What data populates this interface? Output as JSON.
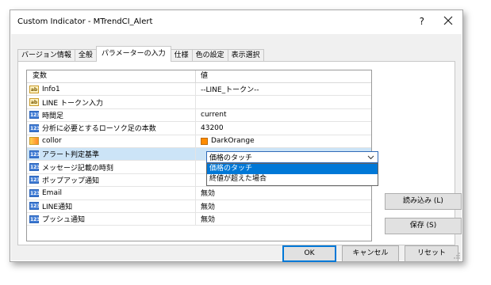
{
  "window": {
    "title": "Custom Indicator - MTrendCI_Alert",
    "help_label": "?"
  },
  "tabs": [
    {
      "label": "バージョン情報"
    },
    {
      "label": "全般"
    },
    {
      "label": "パラメーターの入力"
    },
    {
      "label": "仕様"
    },
    {
      "label": "色の設定"
    },
    {
      "label": "表示選択"
    }
  ],
  "grid": {
    "header_variable": "変数",
    "header_value": "値",
    "rows": [
      {
        "type": "ab",
        "name": "Info1",
        "value": "--LINE_トークン--"
      },
      {
        "type": "ab",
        "name": "LINE トークン入力",
        "value": ""
      },
      {
        "type": "123",
        "name": "時間足",
        "value": "current"
      },
      {
        "type": "123",
        "name": "分析に必要とするローソク足の本数",
        "value": "43200"
      },
      {
        "type": "clr",
        "name": "collor",
        "value": "DarkOrange"
      },
      {
        "type": "123",
        "name": "アラート判定基準",
        "value": ""
      },
      {
        "type": "123",
        "name": "メッセージ記載の時刻",
        "value": ""
      },
      {
        "type": "123",
        "name": "ポップアップ通知",
        "value": ""
      },
      {
        "type": "123",
        "name": "Email",
        "value": "無効"
      },
      {
        "type": "123",
        "name": "LINE通知",
        "value": "無効"
      },
      {
        "type": "123",
        "name": "プッシュ通知",
        "value": "無効"
      }
    ],
    "icon_labels": {
      "ab": "ab",
      "num": "123"
    }
  },
  "dropdown": {
    "selected": "価格のタッチ",
    "options": [
      "価格のタッチ",
      "終値が超えた場合"
    ]
  },
  "buttons": {
    "load": "読み込み (L)",
    "save": "保存 (S)",
    "ok": "OK",
    "cancel": "キャンセル",
    "reset": "リセット"
  },
  "colors": {
    "accent": "#0078d7",
    "swatch": "#ff8c00",
    "selected_row": "#cce4f7"
  }
}
